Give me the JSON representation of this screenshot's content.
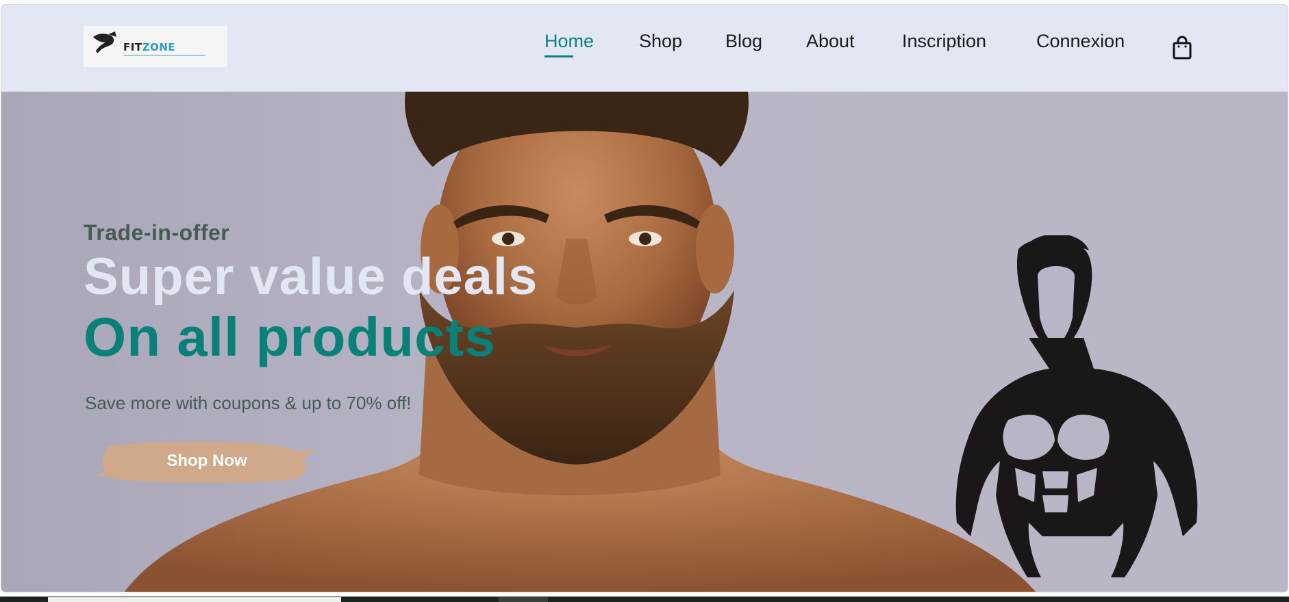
{
  "brand": {
    "logo_text_1": "FIT",
    "logo_text_2": "ZONE"
  },
  "nav": {
    "items": [
      {
        "label": "Home",
        "active": true
      },
      {
        "label": "Shop"
      },
      {
        "label": "Blog"
      },
      {
        "label": "About"
      },
      {
        "label": "Inscription"
      },
      {
        "label": "Connexion"
      }
    ],
    "cart_icon": "shopping-bag-icon"
  },
  "hero": {
    "eyebrow": "Trade-in-offer",
    "headline": "Super value deals",
    "highlight": "On all products",
    "subtext": "Save more with coupons & up to 70% off!",
    "cta_label": "Shop Now"
  },
  "colors": {
    "accent": "#088178",
    "header_bg": "#e3e6f3",
    "hero_bg": "#b7b3c3",
    "cta_brush": "#cfa98a",
    "text_dark": "#465b52"
  }
}
